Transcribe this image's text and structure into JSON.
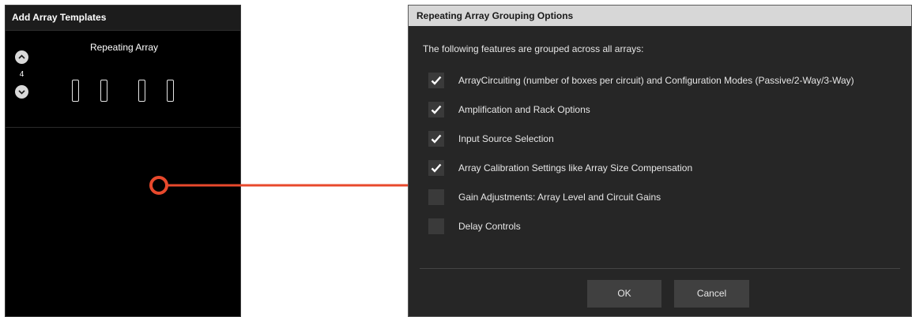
{
  "left_panel": {
    "title": "Add Array Templates",
    "template": {
      "name": "Repeating Array",
      "count": "4",
      "up_icon": "chevron-up-icon",
      "down_icon": "chevron-down-icon"
    }
  },
  "dialog": {
    "title": "Repeating Array Grouping Options",
    "intro": "The following features are grouped across all arrays:",
    "options": [
      {
        "label": "ArrayCircuiting (number of boxes per circuit) and Configuration Modes (Passive/2-Way/3-Way)",
        "checked": true
      },
      {
        "label": "Amplification and Rack Options",
        "checked": true
      },
      {
        "label": "Input Source Selection",
        "checked": true
      },
      {
        "label": "Array Calibration Settings like Array Size Compensation",
        "checked": true
      },
      {
        "label": "Gain Adjustments: Array Level and Circuit Gains",
        "checked": false
      },
      {
        "label": "Delay Controls",
        "checked": false
      }
    ],
    "ok_label": "OK",
    "cancel_label": "Cancel"
  },
  "colors": {
    "connector": "#e8492c",
    "panel_bg": "#000000",
    "dialog_bg": "#262626",
    "title_bar": "#d7d7d7"
  }
}
